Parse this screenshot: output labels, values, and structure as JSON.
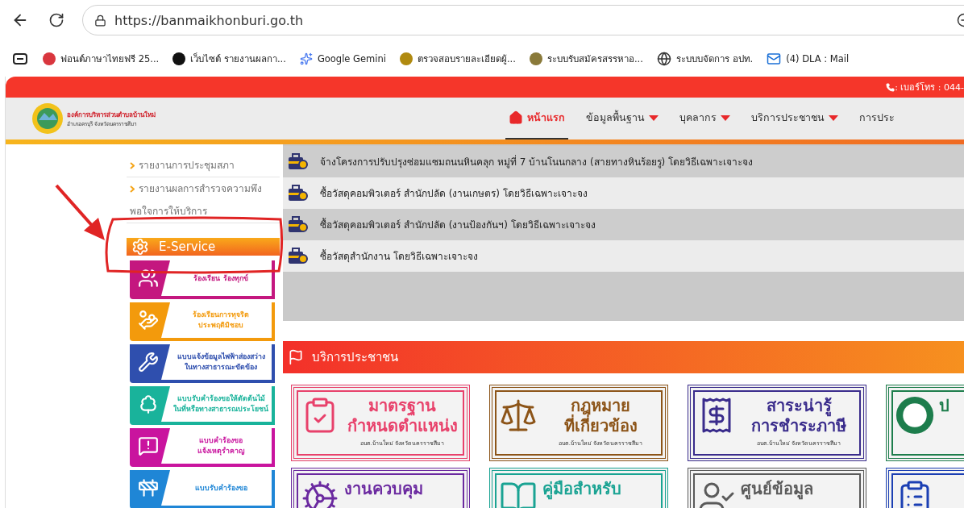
{
  "browser": {
    "url": "https://banmaikhonburi.go.th",
    "bookmarks": [
      {
        "label": "ฟอนต์ภาษาไทยฟรี 25..."
      },
      {
        "label": "เว็บไซต์ รายงานผลกา..."
      },
      {
        "label": "Google Gemini"
      },
      {
        "label": "ตรวจสอบรายละเอียดผู้..."
      },
      {
        "label": "ระบบรับสมัครสรรหาอ..."
      },
      {
        "label": "ระบบบจัดการ อปท."
      },
      {
        "label": "(4) DLA : Mail"
      }
    ]
  },
  "site": {
    "phone": ": เบอร์โทร : 044-",
    "logo": {
      "title": "องค์การบริหารส่วนตำบล**บ้านใหม่**",
      "subtitle": "อำเภอครบุรี จังหวัดนครราชสีมา"
    },
    "nav": [
      {
        "label": "หน้าแรก",
        "selected": true,
        "dropdown": false
      },
      {
        "label": "ข้อมูลพื้นฐาน",
        "selected": false,
        "dropdown": true
      },
      {
        "label": "บุคลากร",
        "selected": false,
        "dropdown": true
      },
      {
        "label": "บริการประชาชน",
        "selected": false,
        "dropdown": true
      },
      {
        "label": "การประ",
        "selected": false,
        "dropdown": false
      }
    ]
  },
  "sidebar": {
    "links": [
      "รายงานการประชุมสภา",
      "รายงานผลการสำรวจความพึงพอใจการให้บริการ"
    ],
    "eservice_title": "E-Service",
    "eservice_items": [
      {
        "lines": [
          "ร้องเรียน ร้องทุกข์"
        ],
        "color": "#c4177f"
      },
      {
        "lines": [
          "ร้องเรียนการทุจริต",
          "ประพฤติมิชอบ"
        ],
        "color": "#f39a0c"
      },
      {
        "lines": [
          "แบบแจ้งข้อมูลไฟฟ้าส่องสว่าง",
          "ในทางสาธารณะขัดข้อง"
        ],
        "color": "#2f4fae"
      },
      {
        "lines": [
          "แบบรับคำร้องขอให้ตัดต้นไม้",
          "ในที่หรือทางสาธารณประโยชน์"
        ],
        "color": "#19b39b"
      },
      {
        "lines": [
          "แบบคำร้องขอ",
          "แจ้งเหตุรำคาญ"
        ],
        "color": "#c9149e"
      },
      {
        "lines": [
          "แบบรับคำร้องขอ"
        ],
        "color": "#1f86d6"
      }
    ]
  },
  "procurement": {
    "rows": [
      "จ้างโครงการปรับปรุงซ่อมแซมถนนหินคลุก หมู่ที่ 7 บ้านโนนกลาง (สายทางหินร้อยรู) โดยวิธีเฉพาะเจาะจง",
      "ซื้อวัสดุคอมพิวเตอร์ สำนักปลัด (งานเกษตร) โดยวิธีเฉพาะเจาะจง",
      "ซื้อวัสดุคอมพิวเตอร์ สำนักปลัด (งานป้องกันฯ) โดยวิธีเฉพาะเจาะจง",
      "ซื้อวัสดุสำนักงาน โดยวิธีเฉพาะเจาะจง"
    ]
  },
  "services": {
    "title": "บริการประชาชน",
    "banners": [
      {
        "title_lines": [
          "มาตรฐาน",
          "กำหนดตำแหน่ง"
        ],
        "caption": "อบต.บ้านใหม่ จังหวัดนครราชสีมา",
        "color": "#e8416b"
      },
      {
        "title_lines": [
          "กฎหมาย",
          "ที่เกี่ยวข้อง"
        ],
        "caption": "อบต.บ้านใหม่ จังหวัดนครราชสีมา",
        "color": "#8c5418"
      },
      {
        "title_lines": [
          "สาระน่ารู้",
          "การชำระภาษี"
        ],
        "caption": "อบต.บ้านใหม่ จังหวัดนครราชสีมา",
        "color": "#3a2c8c"
      },
      {
        "title_lines": [
          "ป"
        ],
        "color": "#1d7d4c"
      },
      {
        "title_lines": [
          "งานควบคุม"
        ],
        "color": "#6b2aa0"
      },
      {
        "title_lines": [
          "คู่มือสำหรับ"
        ],
        "color": "#1aa393"
      },
      {
        "title_lines": [
          "ศูนย์ข้อมูล"
        ],
        "color": "#5a5a5a"
      },
      {
        "color": "#1b3fb3"
      }
    ]
  }
}
